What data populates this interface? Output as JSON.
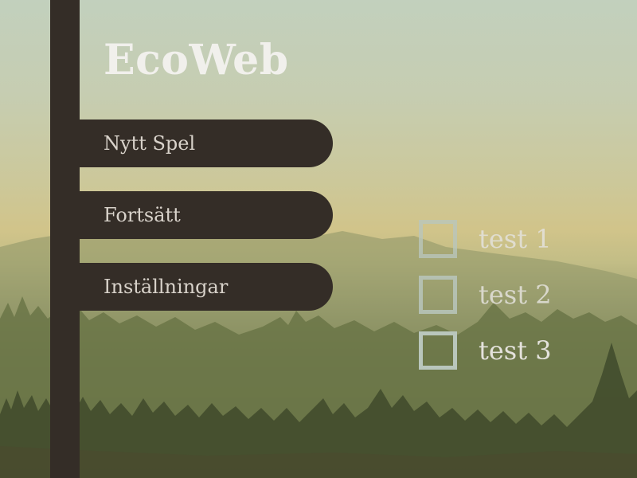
{
  "app": {
    "title": "EcoWeb"
  },
  "menu": {
    "items": [
      {
        "label": "Nytt Spel"
      },
      {
        "label": "Fortsätt"
      },
      {
        "label": "Inställningar"
      }
    ]
  },
  "options": {
    "items": [
      {
        "label": "test 1",
        "checked": false
      },
      {
        "label": "test 2",
        "checked": false
      },
      {
        "label": "test 3",
        "checked": false
      }
    ]
  },
  "colors": {
    "panel": "#342d27",
    "title_text": "#f1f0ec",
    "button_text": "#d8d2ca",
    "checkbox_border": "#b9c6bc",
    "option_text": "#e4e2dc"
  },
  "background": {
    "scene": "misty pine forest"
  }
}
